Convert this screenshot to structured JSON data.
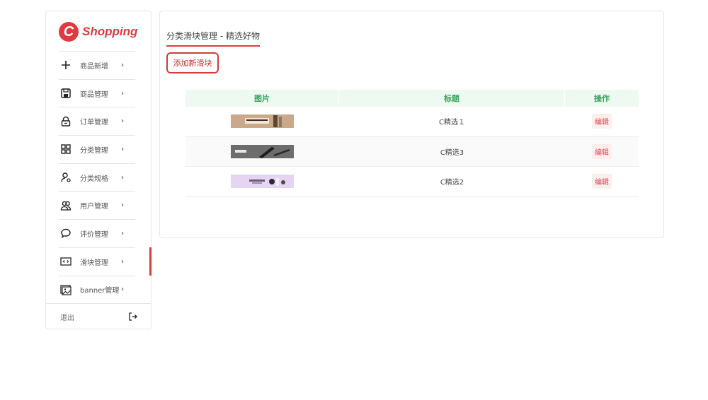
{
  "brand": {
    "logo_letter": "C",
    "name": "Shopping",
    "color": "#e03a3e"
  },
  "sidebar": {
    "items": [
      {
        "label": "商品新增",
        "icon": "plus-icon"
      },
      {
        "label": "商品管理",
        "icon": "save-icon"
      },
      {
        "label": "订单管理",
        "icon": "lock-icon"
      },
      {
        "label": "分类管理",
        "icon": "grid-icon"
      },
      {
        "label": "分类规格",
        "icon": "user-settings-icon"
      },
      {
        "label": "用户管理",
        "icon": "users-icon"
      },
      {
        "label": "评价管理",
        "icon": "chat-icon"
      },
      {
        "label": "滑块管理",
        "icon": "code-icon",
        "active": true
      },
      {
        "label": "banner管理",
        "icon": "image-icon"
      }
    ],
    "chevron": "›",
    "logout_label": "退出"
  },
  "main": {
    "title": "分类滑块管理 - 精选好物",
    "add_button": "添加新滑块",
    "table": {
      "headers": [
        "图片",
        "标题",
        "操作"
      ],
      "rows": [
        {
          "title": "C精选１",
          "action": "编辑",
          "thumb": "brown-banner"
        },
        {
          "title": "C精选3",
          "action": "编辑",
          "thumb": "gray-banner"
        },
        {
          "title": "C精选2",
          "action": "编辑",
          "thumb": "lavender-banner"
        }
      ]
    }
  },
  "colors": {
    "accent": "#e03a3e",
    "header_green": "#3aa35a",
    "header_bg": "#eefaf1"
  }
}
